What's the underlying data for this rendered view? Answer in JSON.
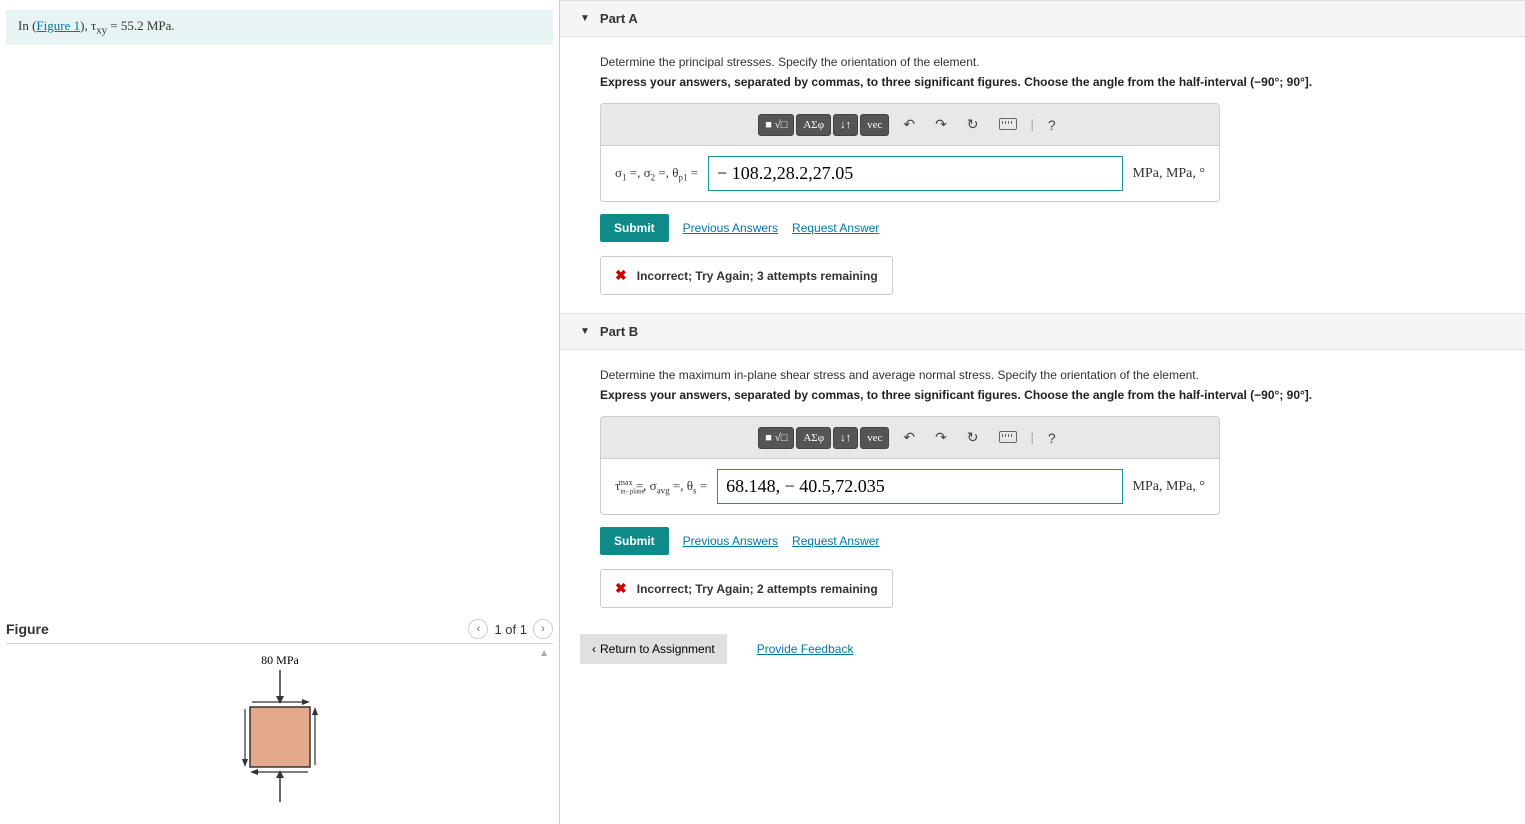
{
  "problem": {
    "prefix": "In (",
    "figure_link": "Figure 1",
    "after_link": "), τ",
    "sub": "xy",
    "equals": " = 55.2 MPa."
  },
  "figure": {
    "title": "Figure",
    "counter": "1 of 1",
    "topLabel": "80 MPa"
  },
  "partA": {
    "title": "Part A",
    "instr1": "Determine the principal stresses. Specify the orientation of the element.",
    "instr2": "Express your answers, separated by commas, to three significant figures. Choose the angle from the half-interval (−90°; 90°].",
    "toolbar": {
      "frac": "■ √□",
      "greek": "ΑΣφ",
      "updown": "↓↑",
      "vec": "vec",
      "undo": "↶",
      "redo": "↷",
      "reset": "↻",
      "kbd": "⌨",
      "help": "?"
    },
    "vars": {
      "s1": "σ",
      "s1sub": "1",
      "s2": "σ",
      "s2sub": "2",
      "th": "θ",
      "thsub": "p1",
      "eq": " =, ",
      "eqend": " = "
    },
    "answer": "− 108.2,28.2,27.05",
    "units": "MPa, MPa, °",
    "submit": "Submit",
    "prev": "Previous Answers",
    "req": "Request Answer",
    "feedback": "Incorrect; Try Again; 3 attempts remaining"
  },
  "partB": {
    "title": "Part B",
    "instr1": "Determine the maximum in-plane shear stress and average normal stress. Specify the orientation of the element.",
    "instr2": "Express your answers, separated by commas, to three significant figures. Choose the angle from the half-interval (−90°; 90°].",
    "toolbar": {
      "frac": "■ √□",
      "greek": "ΑΣφ",
      "updown": "↓↑",
      "vec": "vec",
      "undo": "↶",
      "redo": "↷",
      "reset": "↻",
      "kbd": "⌨",
      "help": "?"
    },
    "vars": {
      "t": "τ",
      "tsup": "max",
      "tsub": "in−plane",
      "savg": "σ",
      "savgsub": "avg",
      "th": "θ",
      "thsub": "s",
      "eq": " =, ",
      "eqend": " = "
    },
    "answer": "68.148, − 40.5,72.035",
    "units": "MPa, MPa, °",
    "submit": "Submit",
    "prev": "Previous Answers",
    "req": "Request Answer",
    "feedback": "Incorrect; Try Again; 2 attempts remaining"
  },
  "bottom": {
    "return": "Return to Assignment",
    "feedback": "Provide Feedback"
  }
}
